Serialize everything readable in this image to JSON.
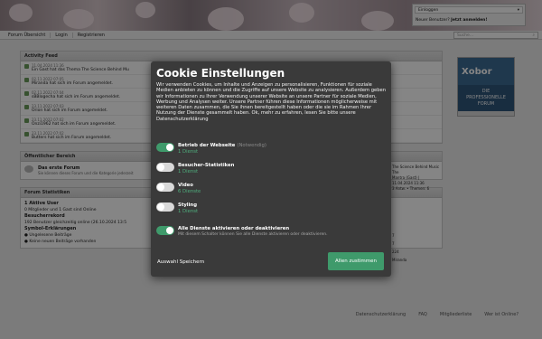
{
  "header": {
    "login": {
      "label": "Einloggen",
      "new_text": "Neuer Benutzer?",
      "new_link": "Jetzt anmelden!"
    }
  },
  "nav": {
    "items": [
      "Forum Übersicht",
      "Login",
      "Registrieren"
    ],
    "search_placeholder": "Suche..."
  },
  "activity": {
    "title": "Activity Feed",
    "items": [
      {
        "time": "11.04.2024 11:36",
        "text": "Ein Gast hat das Thema The Science Behind Mu"
      },
      {
        "time": "02.11.2022 07:05",
        "text": "Miranda hat sich im Forum angemeldet."
      },
      {
        "time": "02.11.2022 07:04",
        "text": "sBBlogecha hat sich im Forum angemeldet."
      },
      {
        "time": "23.11.2022 07:03",
        "text": "Orion hat sich im Forum angemeldet."
      },
      {
        "time": "23.11.2022 07:02",
        "text": "Onzi1962 hat sich im Forum angemeldet."
      },
      {
        "time": "23.11.2022 07:02",
        "text": "Butters hat sich im Forum angemeldet."
      }
    ]
  },
  "public_area": {
    "title": "Öffentlicher Bereich",
    "forum_name": "Das erste Forum",
    "forum_desc": "Sie können dieses Forum und die Kategorie jederzeit",
    "right_lines": [
      "The Science Behind Music The",
      "Mantra (Gast) |",
      "11.04.2024 11:36",
      "3 Antw. • Themen: 6"
    ]
  },
  "stats": {
    "title": "Forum Statistiken",
    "active_title": "1 Aktive User",
    "active_text": "0 Mitglieder und 1 Gast sind Online",
    "record_title": "Besucherrekord",
    "record_text": "192 Benutzer gleichzeitig online (26.10.2024 13:5",
    "symbols_title": "Symbol-Erklärungen",
    "symbol_unread": "Ungelesene Beiträge",
    "symbol_none": "Keine neuen Beiträge vorhanden",
    "right_values": [
      "7",
      "7",
      "224",
      "Miranda"
    ]
  },
  "ad": {
    "brand": "Xobor",
    "line1": "DIE",
    "line2": "PROFESSIONELLE",
    "line3": "FORUM"
  },
  "footer": {
    "links": [
      "Datenschutzerklärung",
      "FAQ",
      "Mitgliederliste",
      "Wer ist Online?"
    ]
  },
  "cookie": {
    "title": "Cookie Einstellungen",
    "text": "Wir verwenden Cookies, um Inhalte und Anzeigen zu personalisieren, Funktionen für soziale Medien anbieten zu können und die Zugriffe auf unsere Website zu analysieren. Außerdem geben wir Informationen zu Ihrer Verwendung unserer Website an unsere Partner für soziale Medien, Werbung und Analysen weiter. Unsere Partner führen diese Informationen möglicherweise mit weiteren Daten zusammen, die Sie ihnen bereitgestellt haben oder die sie im Rahmen Ihrer Nutzung der Dienste gesammelt haben. Ok, mehr zu erfahren, lesen Sie bitte unsere Datenschutzerklärung",
    "options": [
      {
        "label": "Betrieb der Webseite",
        "req": "(Notwendig)",
        "count": "1 Dienst",
        "on": true
      },
      {
        "label": "Besucher-Statistiken",
        "req": "",
        "count": "1 Dienst",
        "on": false
      },
      {
        "label": "Video",
        "req": "",
        "count": "6 Dienste",
        "on": false
      },
      {
        "label": "Styling",
        "req": "",
        "count": "1 Dienst",
        "on": false
      }
    ],
    "all_label": "Alle Dienste aktivieren oder deaktivieren",
    "all_sub": "Mit diesem Schalter können Sie alle Dienste aktivieren oder deaktivieren.",
    "save_label": "Auswahl Speichern",
    "accept_label": "Allen zustimmen",
    "accent": "#3f9a6b"
  }
}
